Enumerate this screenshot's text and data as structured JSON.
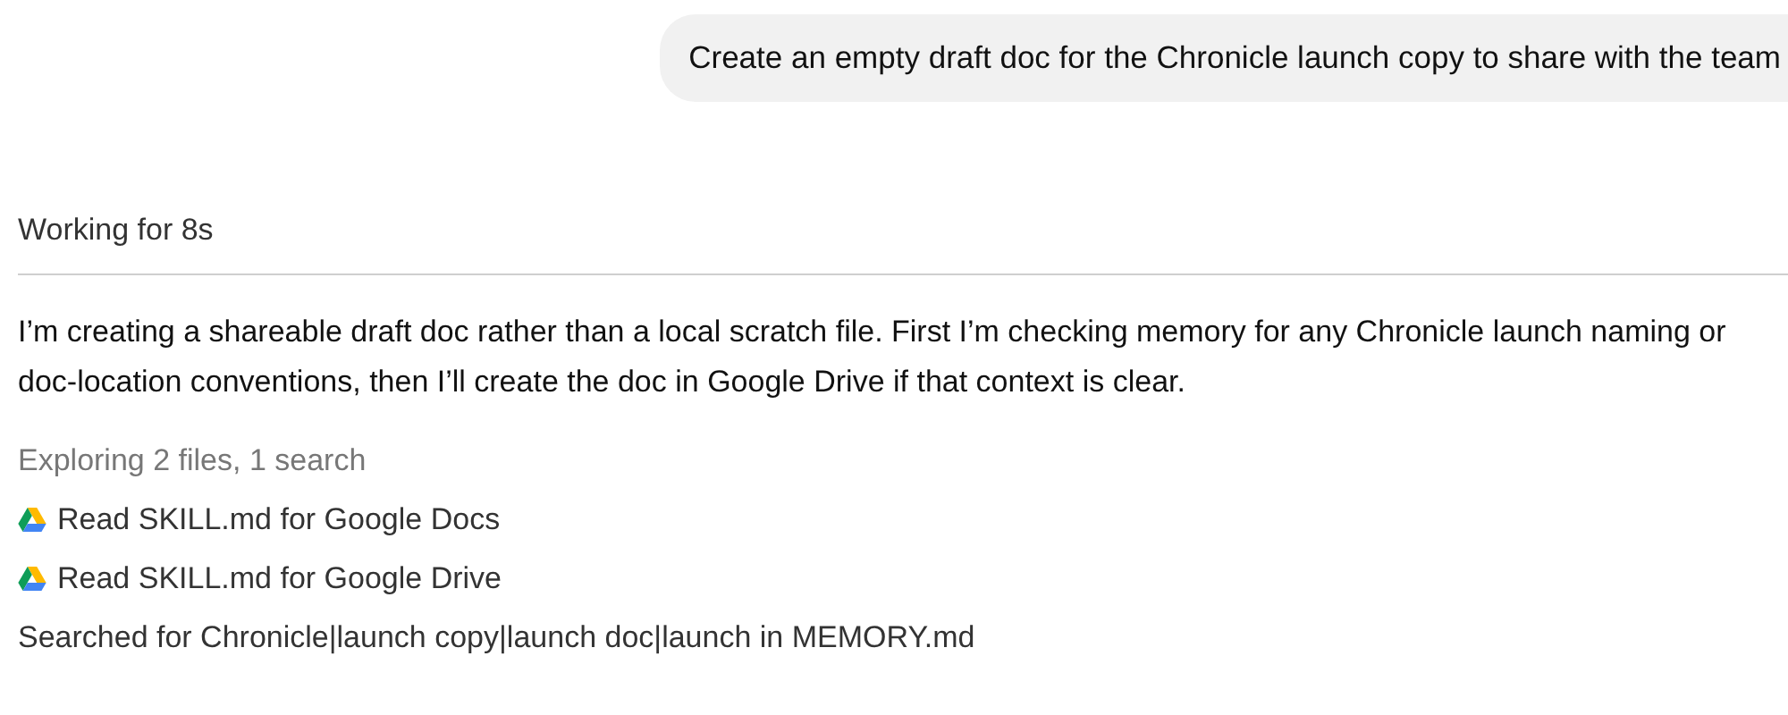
{
  "user_message": "Create an empty draft doc for the Chronicle launch copy to share with the team",
  "status": "Working for 8s",
  "reply": "I’m creating a shareable draft doc rather than a local scratch file. First I’m checking memory for any Chronicle launch naming or doc-location conventions, then I’ll create the doc in Google Drive if that context is clear.",
  "activity": {
    "title": "Exploring 2 files, 1 search",
    "steps": [
      {
        "kind": "drive",
        "text": "Read SKILL.md for Google Docs"
      },
      {
        "kind": "drive",
        "text": "Read SKILL.md for Google Drive"
      },
      {
        "kind": "plain",
        "text": "Searched for Chronicle|launch copy|launch doc|launch in MEMORY.md"
      }
    ]
  }
}
